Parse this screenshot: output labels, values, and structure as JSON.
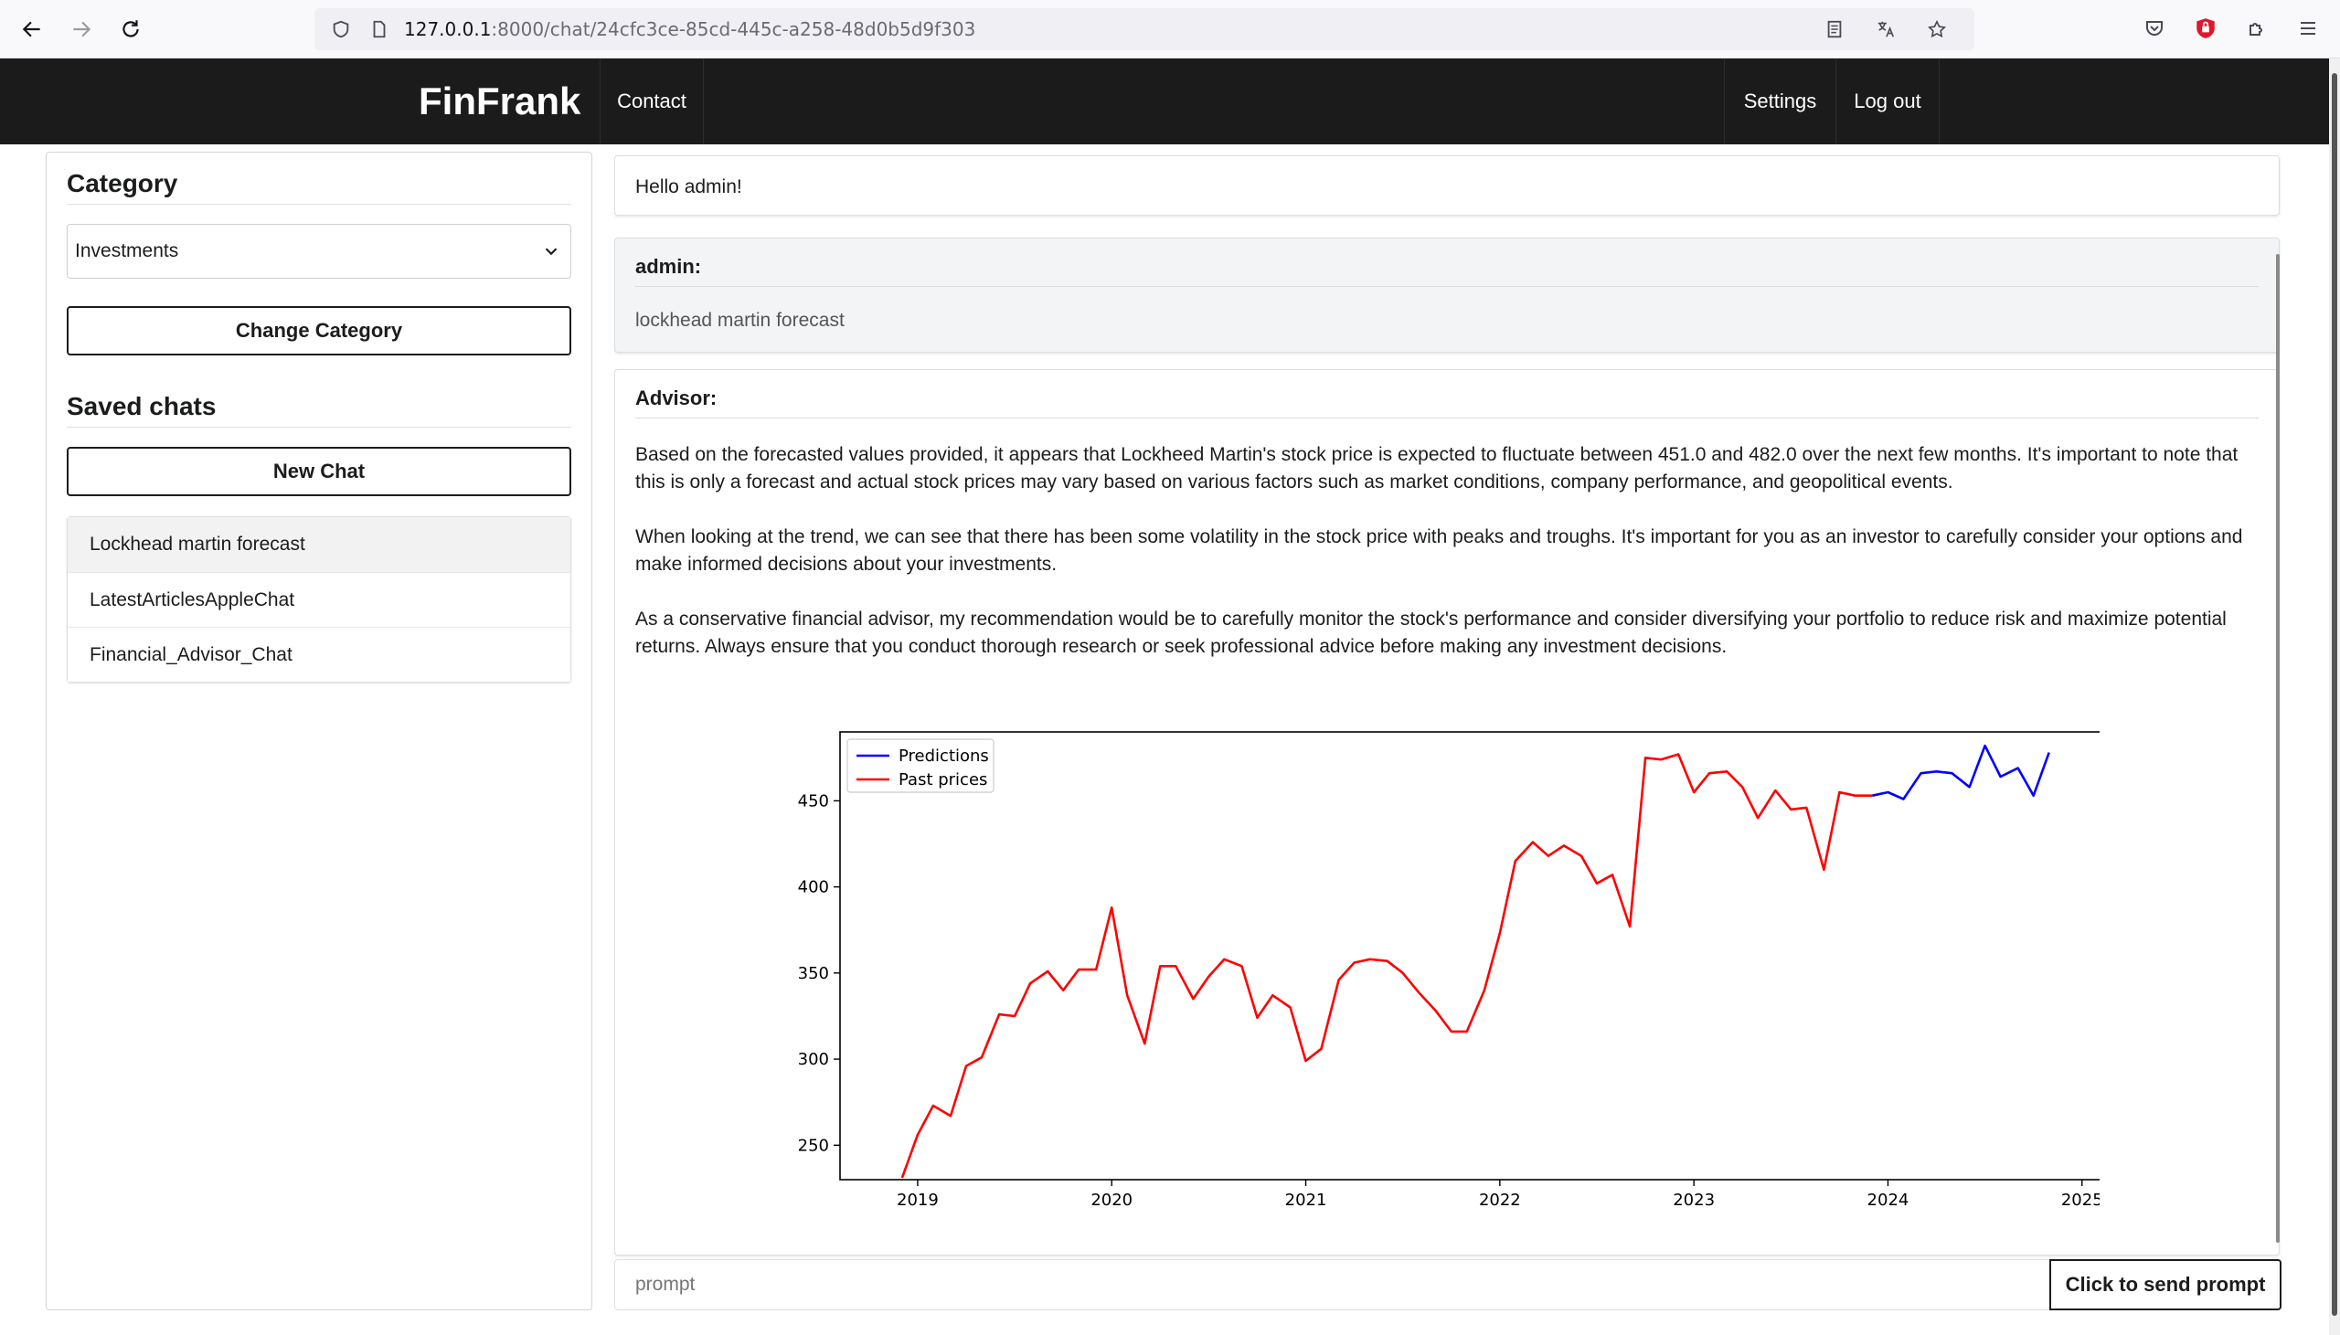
{
  "browser": {
    "url_host": "127.0.0.1",
    "url_path": ":8000/chat/24cfc3ce-85cd-445c-a258-48d0b5d9f303"
  },
  "header": {
    "brand": "FinFrank",
    "nav": {
      "contact": "Contact",
      "settings": "Settings",
      "logout": "Log out"
    }
  },
  "sidebar": {
    "category_title": "Category",
    "category_selected": "Investments",
    "change_category_label": "Change Category",
    "saved_chats_title": "Saved chats",
    "new_chat_label": "New Chat",
    "chats": [
      {
        "label": "Lockhead martin forecast",
        "active": true
      },
      {
        "label": "LatestArticlesAppleChat",
        "active": false
      },
      {
        "label": "Financial_Advisor_Chat",
        "active": false
      }
    ]
  },
  "messages": {
    "greeting": "Hello admin!",
    "user": {
      "sender": "admin:",
      "text": "lockhead martin forecast"
    },
    "advisor": {
      "sender": "Advisor:",
      "paragraphs": [
        "Based on the forecasted values provided, it appears that Lockheed Martin's stock price is expected to fluctuate between 451.0 and 482.0 over the next few months. It's important to note that this is only a forecast and actual stock prices may vary based on various factors such as market conditions, company performance, and geopolitical events.",
        "When looking at the trend, we can see that there has been some volatility in the stock price with peaks and troughs. It's important for you as an investor to carefully consider your options and make informed decisions about your investments.",
        "As a conservative financial advisor, my recommendation would be to carefully monitor the stock's performance and consider diversifying your portfolio to reduce risk and maximize potential returns. Always ensure that you conduct thorough research or seek professional advice before making any investment decisions."
      ]
    }
  },
  "prompt": {
    "placeholder": "prompt",
    "send_label": "Click to send prompt"
  },
  "chart_data": {
    "type": "line",
    "title": "",
    "xlabel": "",
    "ylabel": "",
    "xlim": [
      2018.6,
      2025.1
    ],
    "ylim": [
      230,
      490
    ],
    "x_ticks": [
      "2019",
      "2020",
      "2021",
      "2022",
      "2023",
      "2024",
      "2025"
    ],
    "y_ticks": [
      "250",
      "300",
      "350",
      "400",
      "450"
    ],
    "legend_position": "top-left",
    "series": [
      {
        "name": "Predictions",
        "color": "#0000ff",
        "x": [
          2023.92,
          2024.0,
          2024.08,
          2024.17,
          2024.25,
          2024.33,
          2024.42,
          2024.5,
          2024.58,
          2024.67,
          2024.75,
          2024.83
        ],
        "y": [
          453,
          455,
          451,
          466,
          467,
          466,
          458,
          482,
          464,
          469,
          453,
          478
        ]
      },
      {
        "name": "Past prices",
        "color": "#ff0000",
        "x": [
          2018.92,
          2019.0,
          2019.08,
          2019.17,
          2019.25,
          2019.33,
          2019.42,
          2019.5,
          2019.58,
          2019.67,
          2019.75,
          2019.83,
          2019.92,
          2020.0,
          2020.08,
          2020.17,
          2020.25,
          2020.33,
          2020.42,
          2020.5,
          2020.58,
          2020.67,
          2020.75,
          2020.83,
          2020.92,
          2021.0,
          2021.08,
          2021.17,
          2021.25,
          2021.33,
          2021.42,
          2021.5,
          2021.58,
          2021.67,
          2021.75,
          2021.83,
          2021.92,
          2022.0,
          2022.08,
          2022.17,
          2022.25,
          2022.33,
          2022.42,
          2022.5,
          2022.58,
          2022.67,
          2022.75,
          2022.83,
          2022.92,
          2023.0,
          2023.08,
          2023.17,
          2023.25,
          2023.33,
          2023.42,
          2023.5,
          2023.58,
          2023.67,
          2023.75,
          2023.83,
          2023.92
        ],
        "y": [
          231,
          256,
          273,
          267,
          296,
          301,
          326,
          325,
          344,
          351,
          340,
          352,
          352,
          388,
          337,
          309,
          354,
          354,
          335,
          348,
          358,
          354,
          324,
          337,
          330,
          299,
          306,
          346,
          356,
          358,
          357,
          350,
          339,
          328,
          316,
          316,
          340,
          373,
          415,
          426,
          418,
          424,
          418,
          402,
          407,
          377,
          475,
          474,
          477,
          455,
          466,
          467,
          458,
          440,
          456,
          445,
          446,
          410,
          455,
          453,
          453
        ]
      }
    ]
  }
}
